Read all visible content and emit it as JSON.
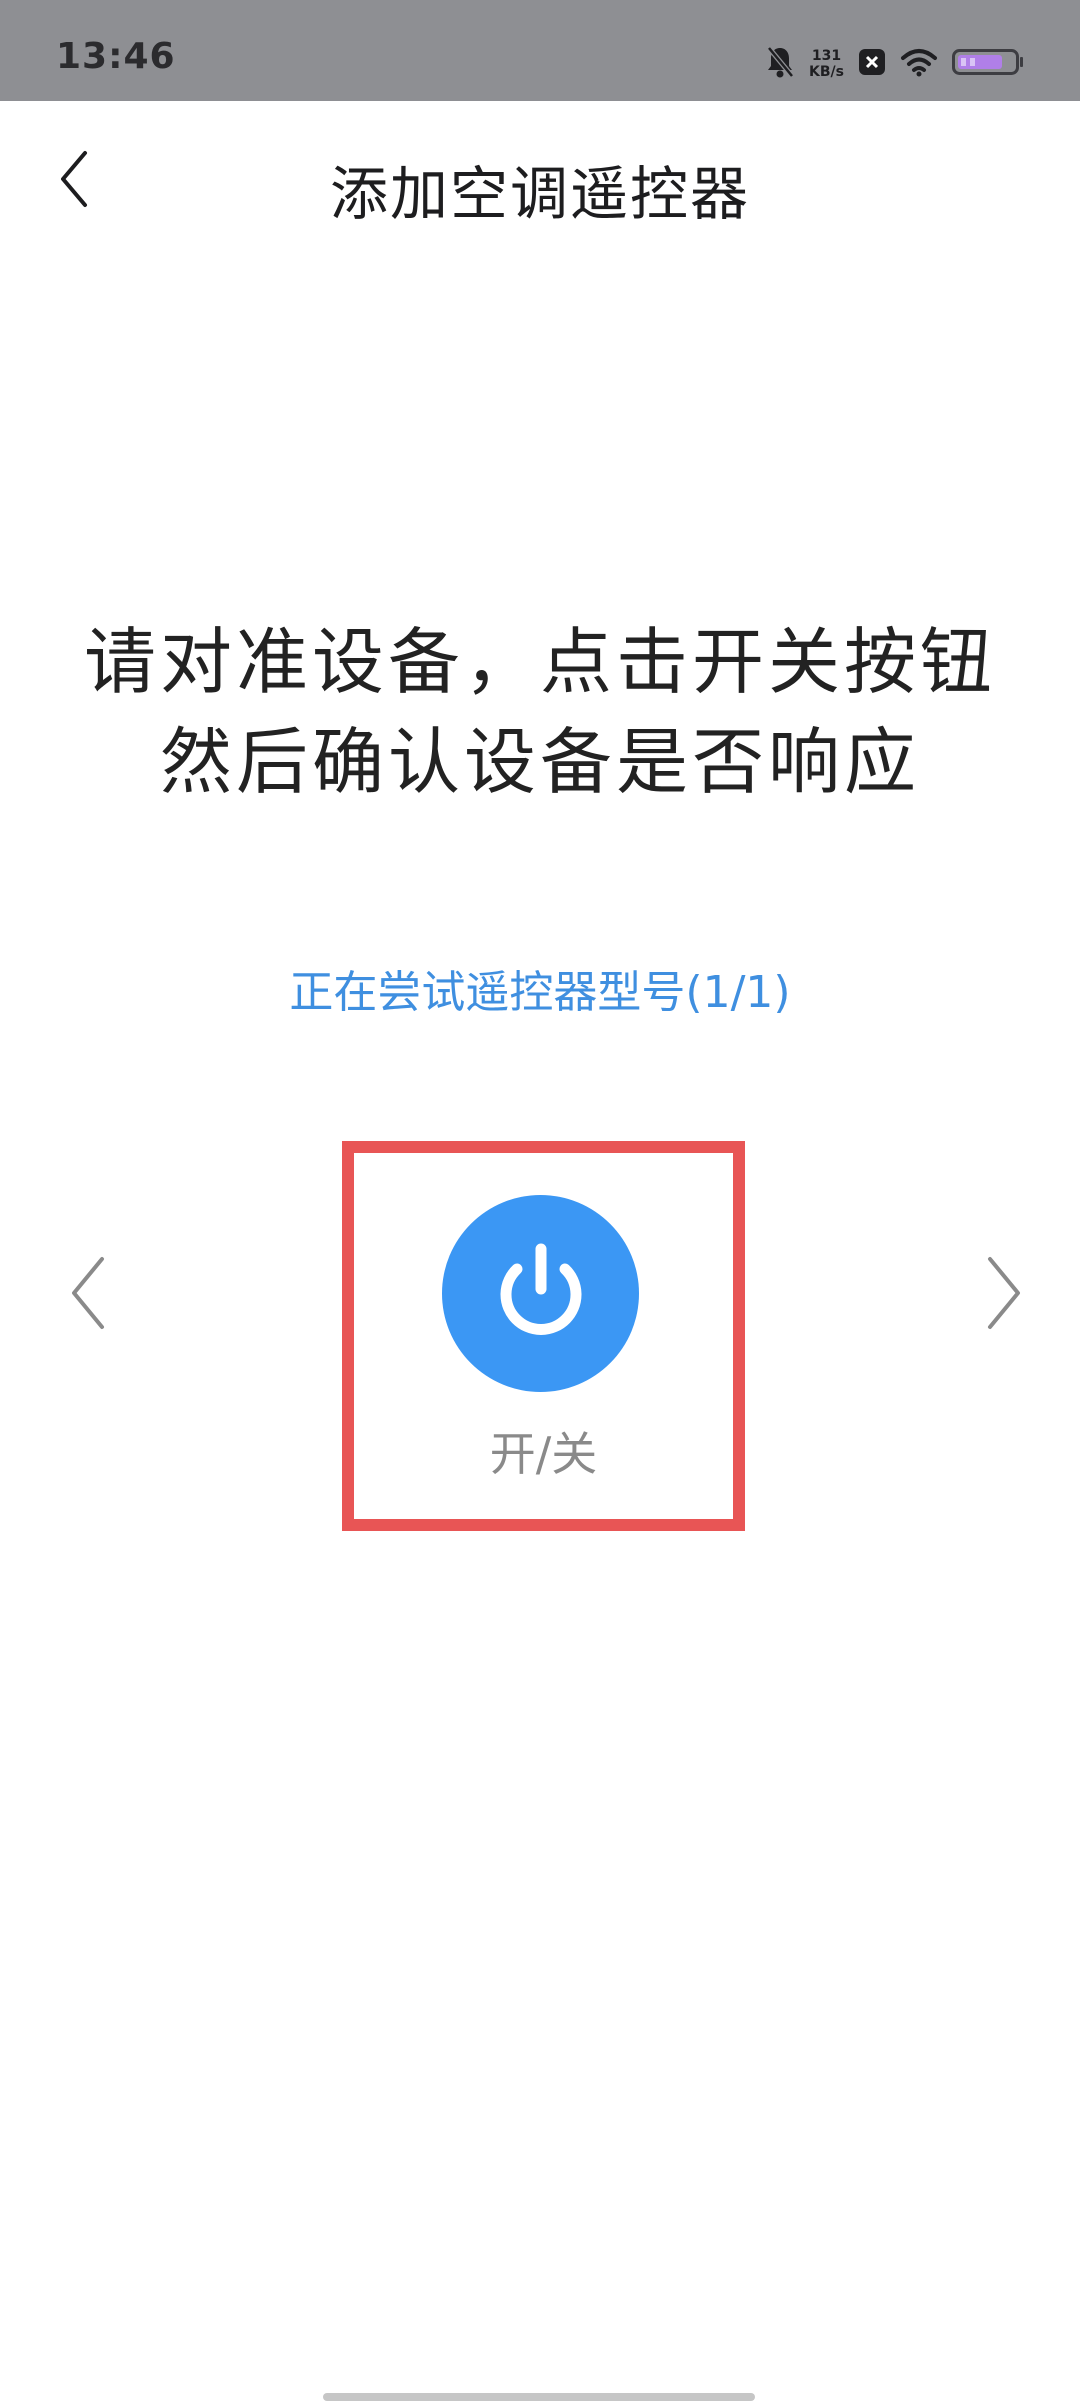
{
  "status_bar": {
    "time": "13:46",
    "net_speed_value": "131",
    "net_speed_unit": "KB/s",
    "icons": [
      "bell-muted-icon",
      "net-speed-indicator",
      "x-box-icon",
      "wifi-icon",
      "battery-icon"
    ]
  },
  "header": {
    "back_icon": "chevron-left-icon",
    "title": "添加空调遥控器"
  },
  "instruction": {
    "line1": "请对准设备，点击开关按钮",
    "line2": "然后确认设备是否响应"
  },
  "trying_status": "正在尝试遥控器型号(1/1)",
  "remote": {
    "prev_icon": "chevron-left-icon",
    "next_icon": "chevron-right-icon",
    "power_icon": "power-icon",
    "power_label": "开/关",
    "button_color": "#3b97f4",
    "highlight_color": "#e85555"
  },
  "colors": {
    "status_bar_bg": "#8e8f93",
    "accent_text": "#3f8fe0"
  }
}
